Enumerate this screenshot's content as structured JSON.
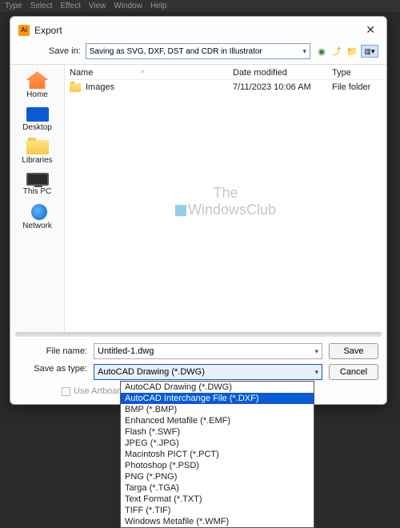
{
  "menubar": [
    "Type",
    "Select",
    "Effect",
    "View",
    "Window",
    "Help"
  ],
  "dialog": {
    "title": "Export",
    "save_in_label": "Save in:",
    "path": "Saving as SVG, DXF, DST and CDR in Illustrator"
  },
  "columns": {
    "name": "Name",
    "date": "Date modified",
    "type": "Type"
  },
  "files": [
    {
      "name": "Images",
      "date": "7/11/2023 10:06 AM",
      "type": "File folder"
    }
  ],
  "places": {
    "home": "Home",
    "desktop": "Desktop",
    "libraries": "Libraries",
    "thispc": "This PC",
    "network": "Network"
  },
  "watermark": {
    "line1": "The",
    "line2_a": "Windows",
    "line2_b": "Club"
  },
  "form": {
    "filename_label": "File name:",
    "filename_value": "Untitled-1.dwg",
    "type_label": "Save as type:",
    "type_selected": "AutoCAD Drawing (*.DWG)",
    "use_artboards": "Use Artboards"
  },
  "buttons": {
    "save": "Save",
    "cancel": "Cancel"
  },
  "type_options": [
    "AutoCAD Drawing (*.DWG)",
    "AutoCAD Interchange File (*.DXF)",
    "BMP (*.BMP)",
    "Enhanced Metafile (*.EMF)",
    "Flash (*.SWF)",
    "JPEG (*.JPG)",
    "Macintosh PICT (*.PCT)",
    "Photoshop (*.PSD)",
    "PNG (*.PNG)",
    "Targa (*.TGA)",
    "Text Format (*.TXT)",
    "TIFF (*.TIF)",
    "Windows Metafile (*.WMF)"
  ],
  "type_highlight_index": 1
}
